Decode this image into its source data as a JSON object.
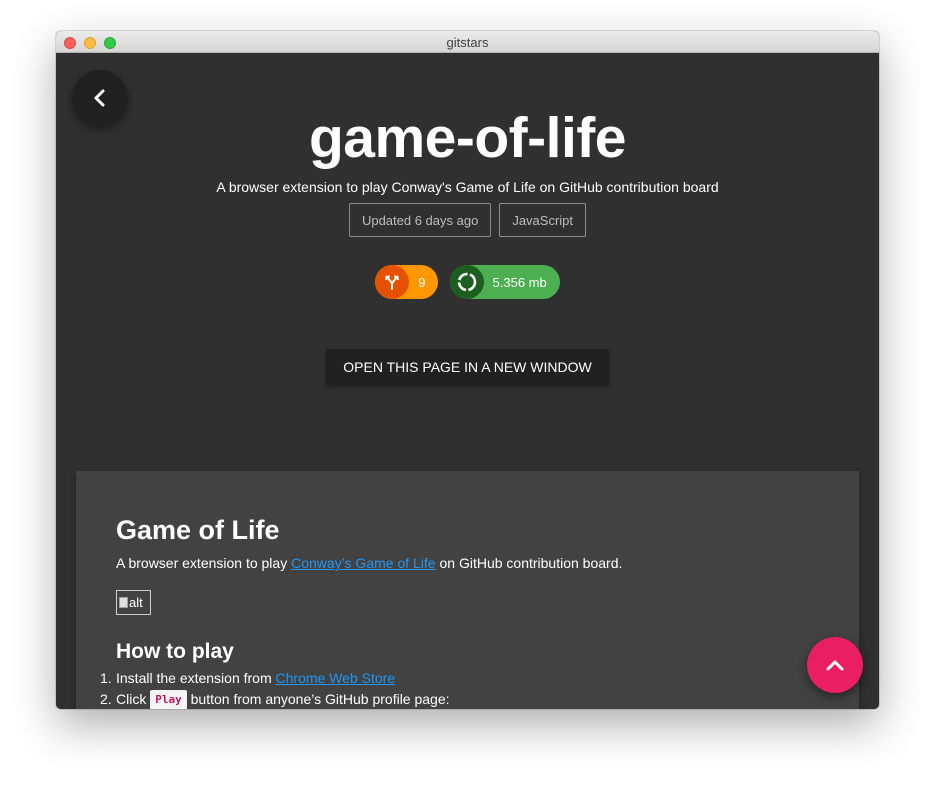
{
  "window": {
    "title": "gitstars"
  },
  "repo": {
    "name": "game-of-life",
    "description": "A browser extension to play Conway's Game of Life on GitHub contribution board",
    "updated": "Updated 6 days ago",
    "language": "JavaScript",
    "forks": "9",
    "size": "5.356 mb"
  },
  "actions": {
    "open_new_window": "OPEN THIS PAGE IN A NEW WINDOW",
    "back_icon": "chevron-left-icon",
    "scroll_top_icon": "chevron-up-icon"
  },
  "readme": {
    "title": "Game of Life",
    "intro_before": "A browser extension to play ",
    "intro_link": "Conway’s Game of Life",
    "intro_after": " on GitHub contribution board.",
    "image_alt": "alt",
    "how_to_heading": "How to play",
    "steps": [
      {
        "num": "1.",
        "before": "Install the extension from ",
        "link": "Chrome Web Store"
      },
      {
        "num": "2.",
        "before": "Click ",
        "code": "Play",
        "after": " button from anyone’s GitHub profile page:"
      }
    ]
  },
  "colors": {
    "background": "#303030",
    "card": "#424242",
    "forks_pill": "#ff9800",
    "size_pill": "#4caf50",
    "fab": "#e91e63",
    "link": "#2196f3"
  }
}
